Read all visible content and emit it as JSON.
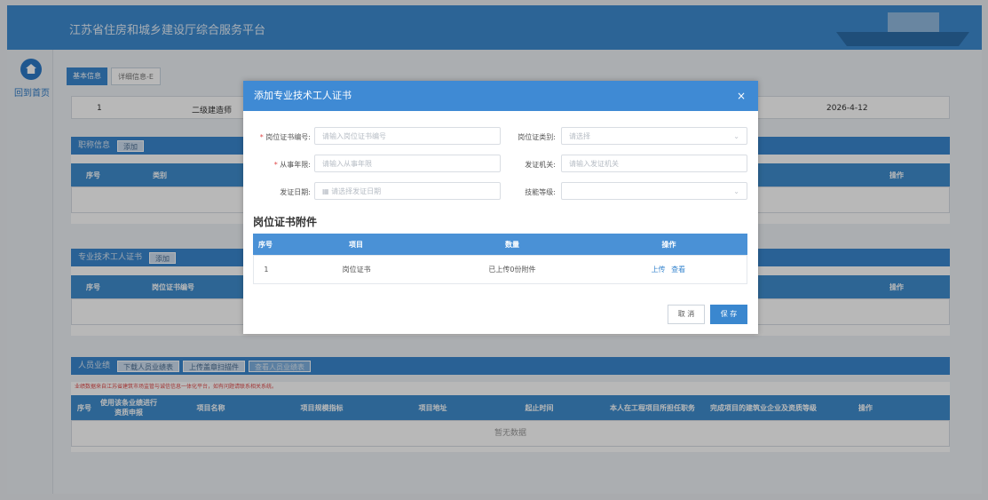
{
  "header": {
    "title": "江苏省住房和城乡建设厅综合服务平台"
  },
  "sidebar": {
    "home_label": "回到首页"
  },
  "tabs": [
    {
      "label": "基本信息"
    },
    {
      "label": "详细信息-E"
    }
  ],
  "cert_row": {
    "index": "1",
    "name": "二级建造师",
    "date": "2026-4-12"
  },
  "title_section": {
    "title": "职称信息",
    "add_label": "添加",
    "columns": [
      "序号",
      "类别",
      "操作"
    ]
  },
  "worker_section": {
    "title": "专业技术工人证书",
    "add_label": "添加",
    "columns": [
      "序号",
      "岗位证书编号",
      "操作"
    ]
  },
  "perf_section": {
    "title": "人员业绩",
    "buttons": [
      "下载人员业绩表",
      "上传盖章扫描件",
      "查看人员业绩表"
    ],
    "note": "业绩数据来自江苏省建筑市场监管与诚信信息一体化平台，如有问题请联系相关系统。",
    "columns": [
      "序号",
      "使用该条业绩进行资质申报",
      "项目名称",
      "项目规模指标",
      "项目地址",
      "起止时间",
      "本人在工程项目所担任职务",
      "完成项目的建筑业企业及资质等级",
      "操作"
    ],
    "empty": "暂无数据"
  },
  "modal": {
    "title": "添加专业技术工人证书",
    "close": "×",
    "fields": {
      "cert_no": {
        "label": "岗位证书编号:",
        "placeholder": "请输入岗位证书编号"
      },
      "cert_type": {
        "label": "岗位证类别:",
        "placeholder": "请选择"
      },
      "years": {
        "label": "从事年限:",
        "placeholder": "请输入从事年限"
      },
      "issuer": {
        "label": "发证机关:",
        "placeholder": "请输入发证机关"
      },
      "issue_date": {
        "label": "发证日期:",
        "placeholder": "请选择发证日期"
      },
      "skill_level": {
        "label": "技能等级:",
        "placeholder": ""
      }
    },
    "attach_title": "岗位证书附件",
    "attach_columns": [
      "序号",
      "项目",
      "数量",
      "操作"
    ],
    "attach_rows": [
      {
        "index": "1",
        "item": "岗位证书",
        "count": "已上传0份附件",
        "upload": "上传",
        "view": "查看"
      }
    ],
    "cancel": "取 消",
    "save": "保 存"
  }
}
